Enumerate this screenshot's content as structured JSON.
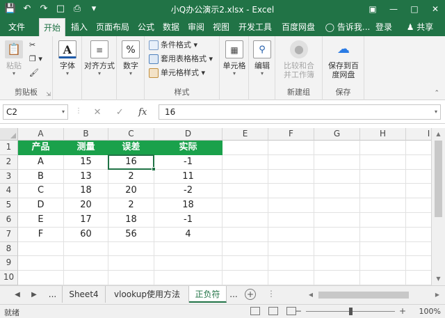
{
  "window": {
    "title": "小Q办公演示2.xlsx - Excel"
  },
  "tabs": [
    {
      "label": "文件"
    },
    {
      "label": "开始"
    },
    {
      "label": "插入"
    },
    {
      "label": "页面布局"
    },
    {
      "label": "公式"
    },
    {
      "label": "数据"
    },
    {
      "label": "审阅"
    },
    {
      "label": "视图"
    },
    {
      "label": "开发工具"
    },
    {
      "label": "百度网盘"
    },
    {
      "label": "告诉我..."
    },
    {
      "label": "登录"
    },
    {
      "label": "共享"
    }
  ],
  "active_tab": "开始",
  "ribbon": {
    "clipboard": {
      "paste": "粘贴",
      "label": "剪贴板"
    },
    "font": {
      "btn": "字体"
    },
    "align": {
      "btn": "对齐方式"
    },
    "number": {
      "btn": "数字"
    },
    "styles": {
      "conditional": "条件格式",
      "table": "套用表格格式",
      "cell": "单元格样式",
      "label": "样式"
    },
    "cells": {
      "btn": "单元格"
    },
    "editing": {
      "btn": "编辑"
    },
    "newgroup": {
      "btn": "比较和合并工作簿",
      "label": "新建组"
    },
    "save": {
      "btn": "保存到百度网盘",
      "label": "保存"
    }
  },
  "formula_bar": {
    "namebox": "C2",
    "value": "16"
  },
  "columns": [
    "A",
    "B",
    "C",
    "D",
    "E",
    "F",
    "G",
    "H",
    "I"
  ],
  "rows": [
    "1",
    "2",
    "3",
    "4",
    "5",
    "6",
    "7",
    "8",
    "9",
    "10"
  ],
  "table": {
    "headers": [
      "产品",
      "测量",
      "误差",
      "实际"
    ],
    "data": [
      [
        "A",
        "15",
        "16",
        "-1"
      ],
      [
        "B",
        "13",
        "2",
        "11"
      ],
      [
        "C",
        "18",
        "20",
        "-2"
      ],
      [
        "D",
        "20",
        "2",
        "18"
      ],
      [
        "E",
        "17",
        "18",
        "-1"
      ],
      [
        "F",
        "60",
        "56",
        "4"
      ]
    ]
  },
  "sheets": {
    "more_left": "...",
    "tabs": [
      "Sheet4",
      "vlookup使用方法",
      "正负符"
    ],
    "active": "正负符",
    "more_right": "..."
  },
  "status": {
    "ready": "就绪",
    "zoom": "100%",
    "zoom_fraction": 0.5
  },
  "colors": {
    "excel_green": "#217346",
    "header_fill": "#1aa14b"
  }
}
